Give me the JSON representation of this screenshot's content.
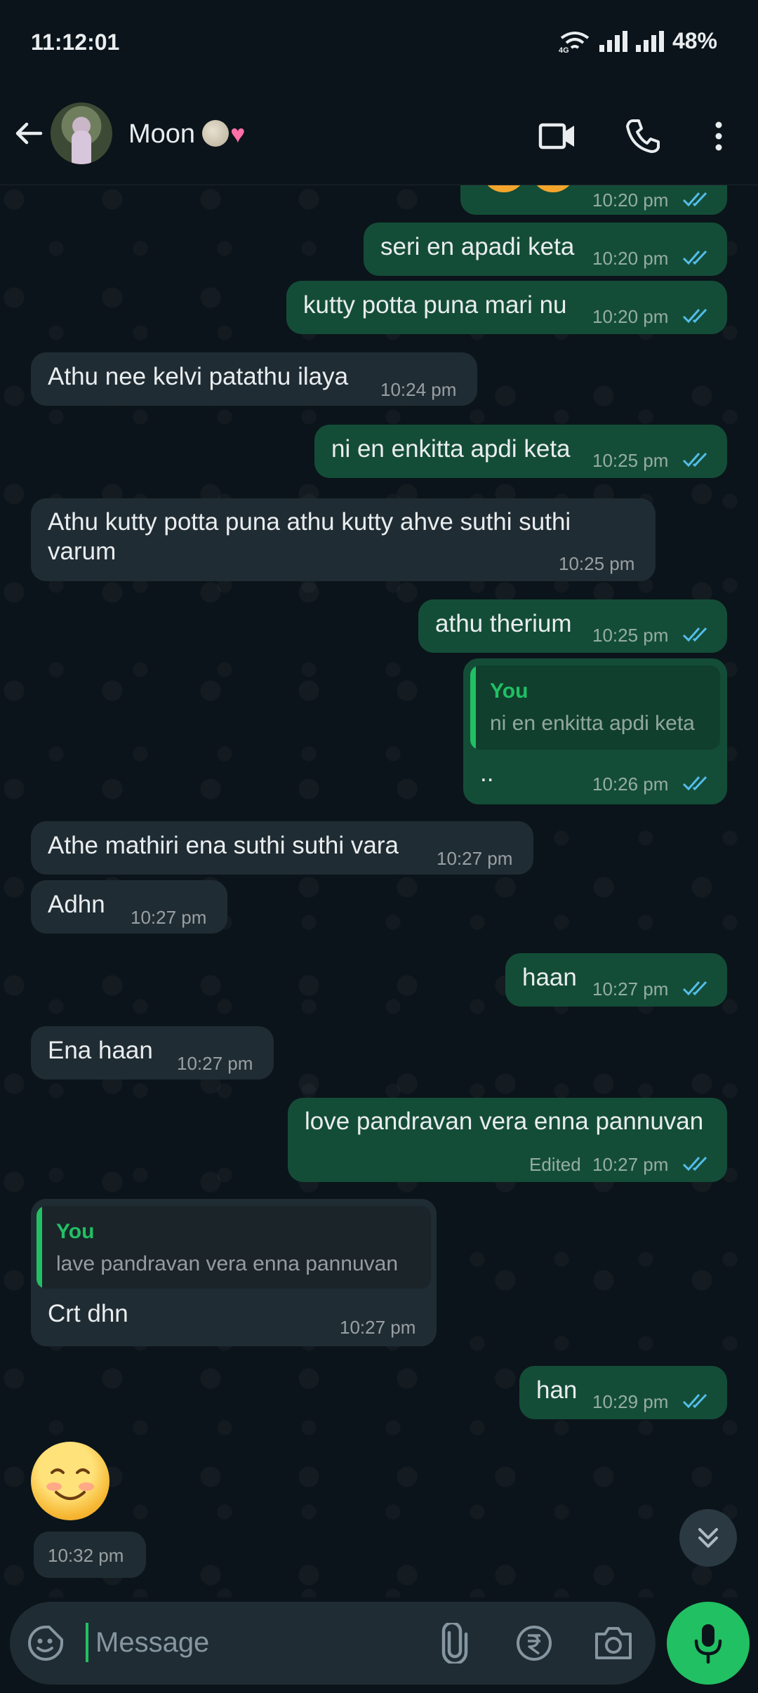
{
  "status_bar": {
    "time": "11:12:01",
    "network": "4G",
    "battery": "48%"
  },
  "header": {
    "contact_name": "Moon",
    "icons": [
      "back-arrow-icon",
      "video-call-icon",
      "voice-call-icon",
      "more-options-icon"
    ]
  },
  "messages": [
    {
      "dir": "out",
      "text": "",
      "time": "10:20 pm",
      "ticks": "read"
    },
    {
      "dir": "out",
      "text": "seri en apadi keta",
      "time": "10:20 pm",
      "ticks": "read"
    },
    {
      "dir": "out",
      "text": "kutty potta puna mari nu",
      "time": "10:20 pm",
      "ticks": "read"
    },
    {
      "dir": "in",
      "text": "Athu nee kelvi patathu ilaya",
      "time": "10:24 pm"
    },
    {
      "dir": "out",
      "text": "ni en enkitta apdi keta",
      "time": "10:25 pm",
      "ticks": "read"
    },
    {
      "dir": "in",
      "text_line1": "Athu kutty potta puna athu kutty ahve suthi suthi",
      "text_line2": "varum",
      "time": "10:25 pm"
    },
    {
      "dir": "out",
      "text": "athu therium",
      "time": "10:25 pm",
      "ticks": "read"
    },
    {
      "dir": "out",
      "quote_author": "You",
      "quote_text": "ni en enkitta apdi keta",
      "text": "..",
      "time": "10:26 pm",
      "ticks": "read"
    },
    {
      "dir": "in",
      "text": "Athe mathiri ena suthi suthi vara",
      "time": "10:27 pm"
    },
    {
      "dir": "in",
      "text": "Adhn",
      "time": "10:27 pm"
    },
    {
      "dir": "out",
      "text": "haan",
      "time": "10:27 pm",
      "ticks": "read"
    },
    {
      "dir": "in",
      "text": "Ena haan",
      "time": "10:27 pm"
    },
    {
      "dir": "out",
      "text": "love pandravan vera enna pannuvan",
      "edited": "Edited",
      "time": "10:27 pm",
      "ticks": "read"
    },
    {
      "dir": "in",
      "quote_author": "You",
      "quote_text": "lave pandravan vera enna pannuvan",
      "text": "Crt dhn",
      "time": "10:27 pm"
    },
    {
      "dir": "out",
      "text": "han",
      "time": "10:29 pm",
      "ticks": "read"
    },
    {
      "dir": "in",
      "emoji": "smiling-face-emoji",
      "time": "10:32 pm"
    }
  ],
  "composer": {
    "placeholder": "Message"
  },
  "colors": {
    "outgoing_bubble": "#144d37",
    "incoming_bubble": "#202c33",
    "accent": "#21c063",
    "read_ticks": "#53bdeb"
  }
}
